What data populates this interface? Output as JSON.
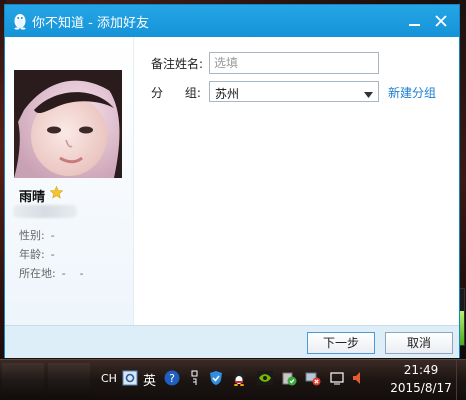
{
  "window": {
    "title": "你不知道 - 添加好友"
  },
  "profile": {
    "nickname": "雨晴",
    "gender_label": "性别:",
    "gender_value": "-",
    "age_label": "年龄:",
    "age_value": "-",
    "location_label": "所在地:",
    "location_value": "-    -"
  },
  "form": {
    "remark_label": "备注姓名:",
    "remark_placeholder": "选填",
    "remark_value": "",
    "group_label": "分 组:",
    "group_selected": "苏州",
    "new_group_link": "新建分组"
  },
  "buttons": {
    "next": "下一步",
    "cancel": "取消"
  },
  "taskbar": {
    "lang_code": "CH",
    "ime_label": "英",
    "clock_time": "21:49",
    "clock_date": "2015/8/17"
  },
  "colors": {
    "titlebar": "#1693d8",
    "link": "#1b7fcf",
    "footer": "#ddeef8"
  },
  "volume_level": 0.6
}
